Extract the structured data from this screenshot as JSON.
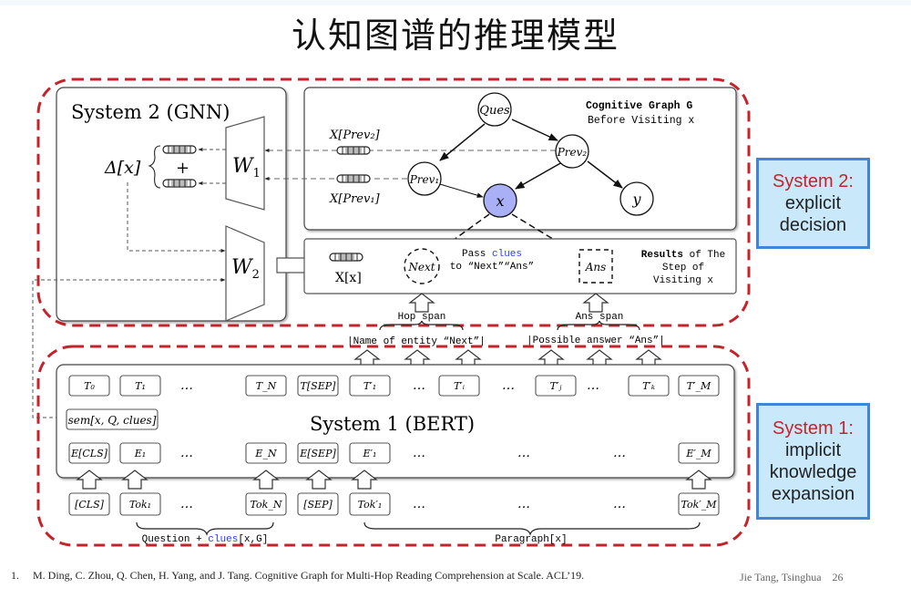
{
  "slide": {
    "title": "认知图谱的推理模型",
    "page_number": "26",
    "author": "Jie Tang, Tsinghua",
    "footnote": {
      "index": "1.",
      "text": "M. Ding, C. Zhou, Q. Chen, H. Yang, and J. Tang. Cognitive Graph for Multi-Hop Reading Comprehension at Scale. ACL’19."
    }
  },
  "colors": {
    "dashed_border": "#c5232b",
    "callout_bg": "#c9e9fb",
    "callout_border": "#3f86d6",
    "highlight_node": "#aab0f5",
    "clues_blue": "#2b3df0"
  },
  "system2": {
    "gnn_title": "System 2 (GNN)",
    "delta_label": "Δ[x]",
    "plus": "+",
    "w1": "W",
    "w1_sub": "1",
    "w2": "W",
    "w2_sub": "2",
    "graph_title": "Cognitive Graph G",
    "graph_subtitle": "Before Visiting x",
    "x_prev2": "X[Prev₂]",
    "x_prev1": "X[Prev₁]",
    "nodes": {
      "ques": "Ques",
      "prev2": "Prev₂",
      "prev1": "Prev₁",
      "x": "x",
      "y": "y",
      "next": "Next",
      "ans": "Ans"
    },
    "xx_label": "X[x]",
    "pass_1": "Pass ",
    "pass_clues": "clues",
    "pass_2": "to “Next”“Ans”",
    "results_bold": "Results",
    "results_1": " of The",
    "results_2": "Step of",
    "results_3": "Visiting x",
    "hop_span": "Hop span",
    "ans_span": "Ans span",
    "entity_span": "|Name of entity “Next”|",
    "answer_span": "|Possible answer “Ans”|"
  },
  "system1": {
    "bert_title": "System 1 (BERT)",
    "sem_label": "sem[x, Q, clues]",
    "t_row": [
      "T₀",
      "T₁",
      "…",
      "T_N",
      "T[SEP]",
      "T′₁",
      "…",
      "T′ᵢ",
      "…",
      "T′ⱼ",
      "…",
      "T′ₖ",
      "T′_M"
    ],
    "e_row": [
      "E[CLS]",
      "E₁",
      "…",
      "E_N",
      "E[SEP]",
      "E′₁",
      "…",
      "…",
      "…",
      "E′_M"
    ],
    "tok_row": [
      "[CLS]",
      "Tok₁",
      "…",
      "Tok_N",
      "[SEP]",
      "Tok′₁",
      "…",
      "…",
      "…",
      "Tok′_M"
    ],
    "question_label_1": "Question + ",
    "question_label_clues": "clues",
    "question_label_2": "[x,G]",
    "paragraph_label": "Paragraph[x]"
  },
  "callouts": {
    "system2": {
      "heading": "System 2:",
      "lines": [
        "explicit",
        "decision"
      ]
    },
    "system1": {
      "heading": "System 1:",
      "lines": [
        "implicit",
        "knowledge",
        "expansion"
      ]
    }
  }
}
